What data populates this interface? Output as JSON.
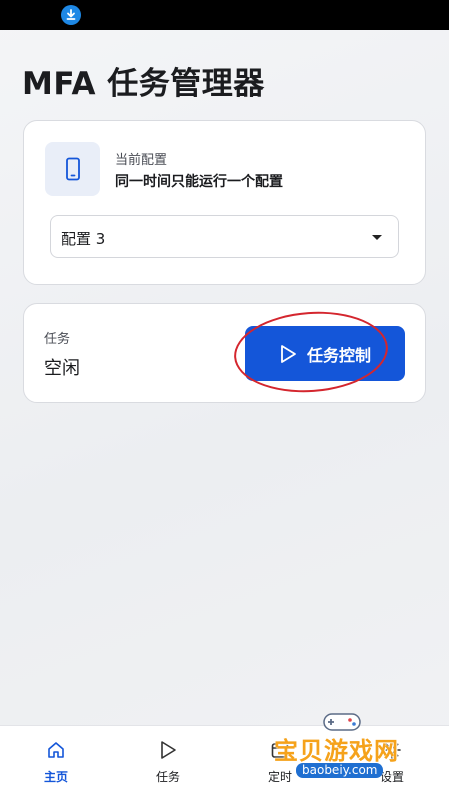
{
  "page": {
    "title": "MFA 任务管理器"
  },
  "config_card": {
    "caption": "当前配置",
    "description": "同一时间只能运行一个配置",
    "icon": "phone-icon",
    "select_value": "配置 3"
  },
  "task_card": {
    "caption": "任务",
    "status": "空闲",
    "button_label": "任务控制",
    "button_icon": "play-icon"
  },
  "bottom_nav": {
    "items": [
      {
        "label": "主页",
        "icon": "home-icon",
        "active": true
      },
      {
        "label": "任务",
        "icon": "play-icon",
        "active": false
      },
      {
        "label": "定时",
        "icon": "calendar-icon",
        "active": false
      },
      {
        "label": "设置",
        "icon": "gear-icon",
        "active": false
      }
    ]
  },
  "watermark": {
    "title": "宝贝游戏网",
    "url": "baobeiy.com"
  },
  "colors": {
    "accent": "#1456d9",
    "annotation_ring": "#d4262e",
    "statusbar": "#000000"
  }
}
